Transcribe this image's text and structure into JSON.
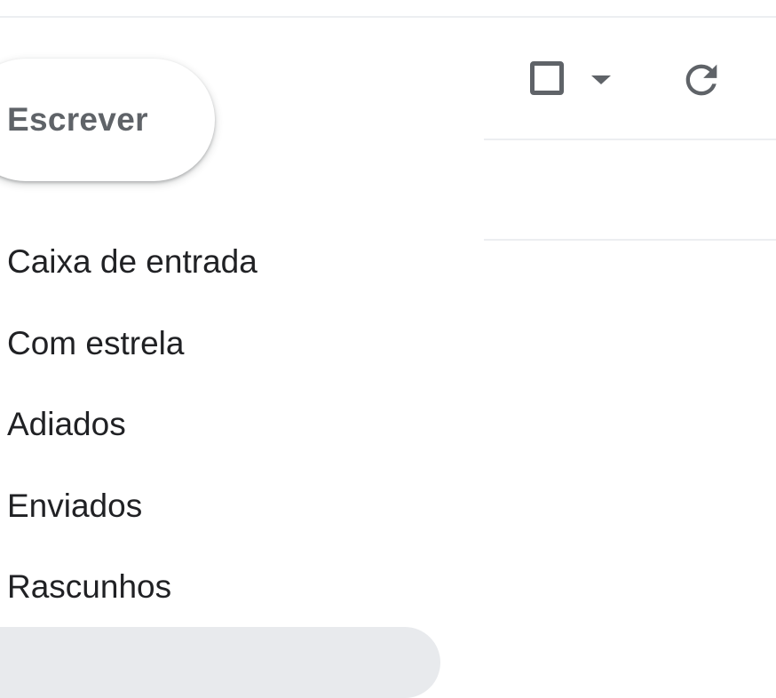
{
  "sidebar": {
    "compose_label": "Escrever",
    "items": [
      {
        "label": "Caixa de entrada"
      },
      {
        "label": "Com estrela"
      },
      {
        "label": "Adiados"
      },
      {
        "label": "Enviados"
      },
      {
        "label": "Rascunhos"
      }
    ]
  },
  "toolbar": {
    "select_icon": "checkbox-outline-icon",
    "select_menu_icon": "caret-down-icon",
    "refresh_icon": "refresh-icon"
  },
  "colors": {
    "icon": "#5f6368",
    "text": "#202124",
    "divider": "#eceef1",
    "highlight": "#e8eaed"
  }
}
